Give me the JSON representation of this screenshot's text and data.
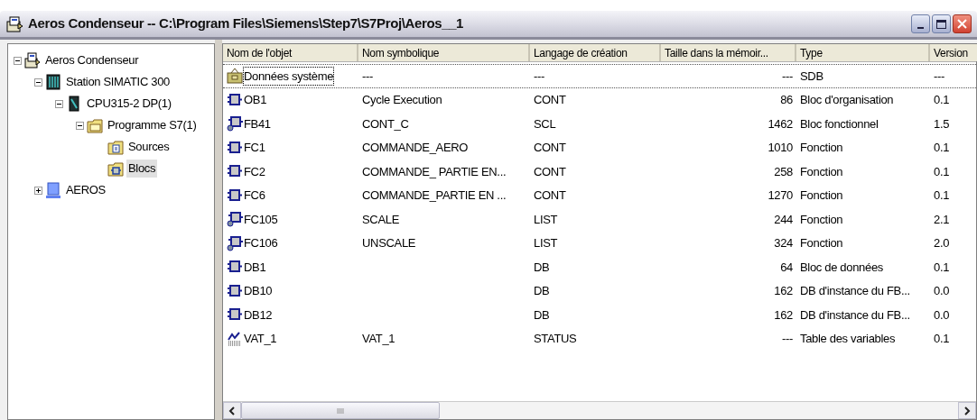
{
  "window": {
    "title": "Aeros Condenseur -- C:\\Program Files\\Siemens\\Step7\\S7Proj\\Aeros__1"
  },
  "tree": [
    {
      "label": "Aeros Condenseur",
      "kind": "project",
      "expanded": true,
      "selected": false,
      "children": [
        {
          "label": "Station SIMATIC 300",
          "kind": "station",
          "expanded": true,
          "selected": false,
          "children": [
            {
              "label": "CPU315-2 DP(1)",
              "kind": "cpu",
              "expanded": true,
              "selected": false,
              "children": [
                {
                  "label": "Programme S7(1)",
                  "kind": "program",
                  "expanded": true,
                  "selected": false,
                  "children": [
                    {
                      "label": "Sources",
                      "kind": "sources",
                      "selected": false
                    },
                    {
                      "label": "Blocs",
                      "kind": "blocks",
                      "selected": true
                    }
                  ]
                }
              ]
            }
          ]
        },
        {
          "label": "AEROS",
          "kind": "pc",
          "expanded": false,
          "selected": false
        }
      ]
    }
  ],
  "table": {
    "columns": [
      "Nom de l'objet",
      "Nom symbolique",
      "Langage de création",
      "Taille dans la mémoir...",
      "Type",
      "Version"
    ],
    "rows": [
      {
        "kind": "system",
        "selected": true,
        "cells": [
          "Données système",
          "---",
          "---",
          "---",
          "SDB",
          "---"
        ]
      },
      {
        "kind": "block",
        "selected": false,
        "cells": [
          "OB1",
          "Cycle Execution",
          "CONT",
          "86",
          "Bloc d'organisation",
          "0.1"
        ]
      },
      {
        "kind": "block-protected",
        "selected": false,
        "cells": [
          "FB41",
          "CONT_C",
          "SCL",
          "1462",
          "Bloc fonctionnel",
          "1.5"
        ]
      },
      {
        "kind": "block",
        "selected": false,
        "cells": [
          "FC1",
          "COMMANDE_AERO",
          "CONT",
          "1010",
          "Fonction",
          "0.1"
        ]
      },
      {
        "kind": "block",
        "selected": false,
        "cells": [
          "FC2",
          "COMMANDE_ PARTIE EN...",
          "CONT",
          "258",
          "Fonction",
          "0.1"
        ]
      },
      {
        "kind": "block",
        "selected": false,
        "cells": [
          "FC6",
          "COMMANDE_PARTIE EN ...",
          "CONT",
          "1270",
          "Fonction",
          "0.1"
        ]
      },
      {
        "kind": "block-protected",
        "selected": false,
        "cells": [
          "FC105",
          "SCALE",
          "LIST",
          "244",
          "Fonction",
          "2.1"
        ]
      },
      {
        "kind": "block-protected",
        "selected": false,
        "cells": [
          "FC106",
          "UNSCALE",
          "LIST",
          "324",
          "Fonction",
          "2.0"
        ]
      },
      {
        "kind": "block",
        "selected": false,
        "cells": [
          "DB1",
          "",
          "DB",
          "64",
          "Bloc de données",
          "0.1"
        ]
      },
      {
        "kind": "block",
        "selected": false,
        "cells": [
          "DB10",
          "",
          "DB",
          "162",
          "DB d'instance du FB...",
          "0.0"
        ]
      },
      {
        "kind": "block",
        "selected": false,
        "cells": [
          "DB12",
          "",
          "DB",
          "162",
          "DB d'instance du FB...",
          "0.0"
        ]
      },
      {
        "kind": "vat",
        "selected": false,
        "cells": [
          "VAT_1",
          "VAT_1",
          "STATUS",
          "---",
          "Table des variables",
          "0.1"
        ]
      }
    ]
  }
}
